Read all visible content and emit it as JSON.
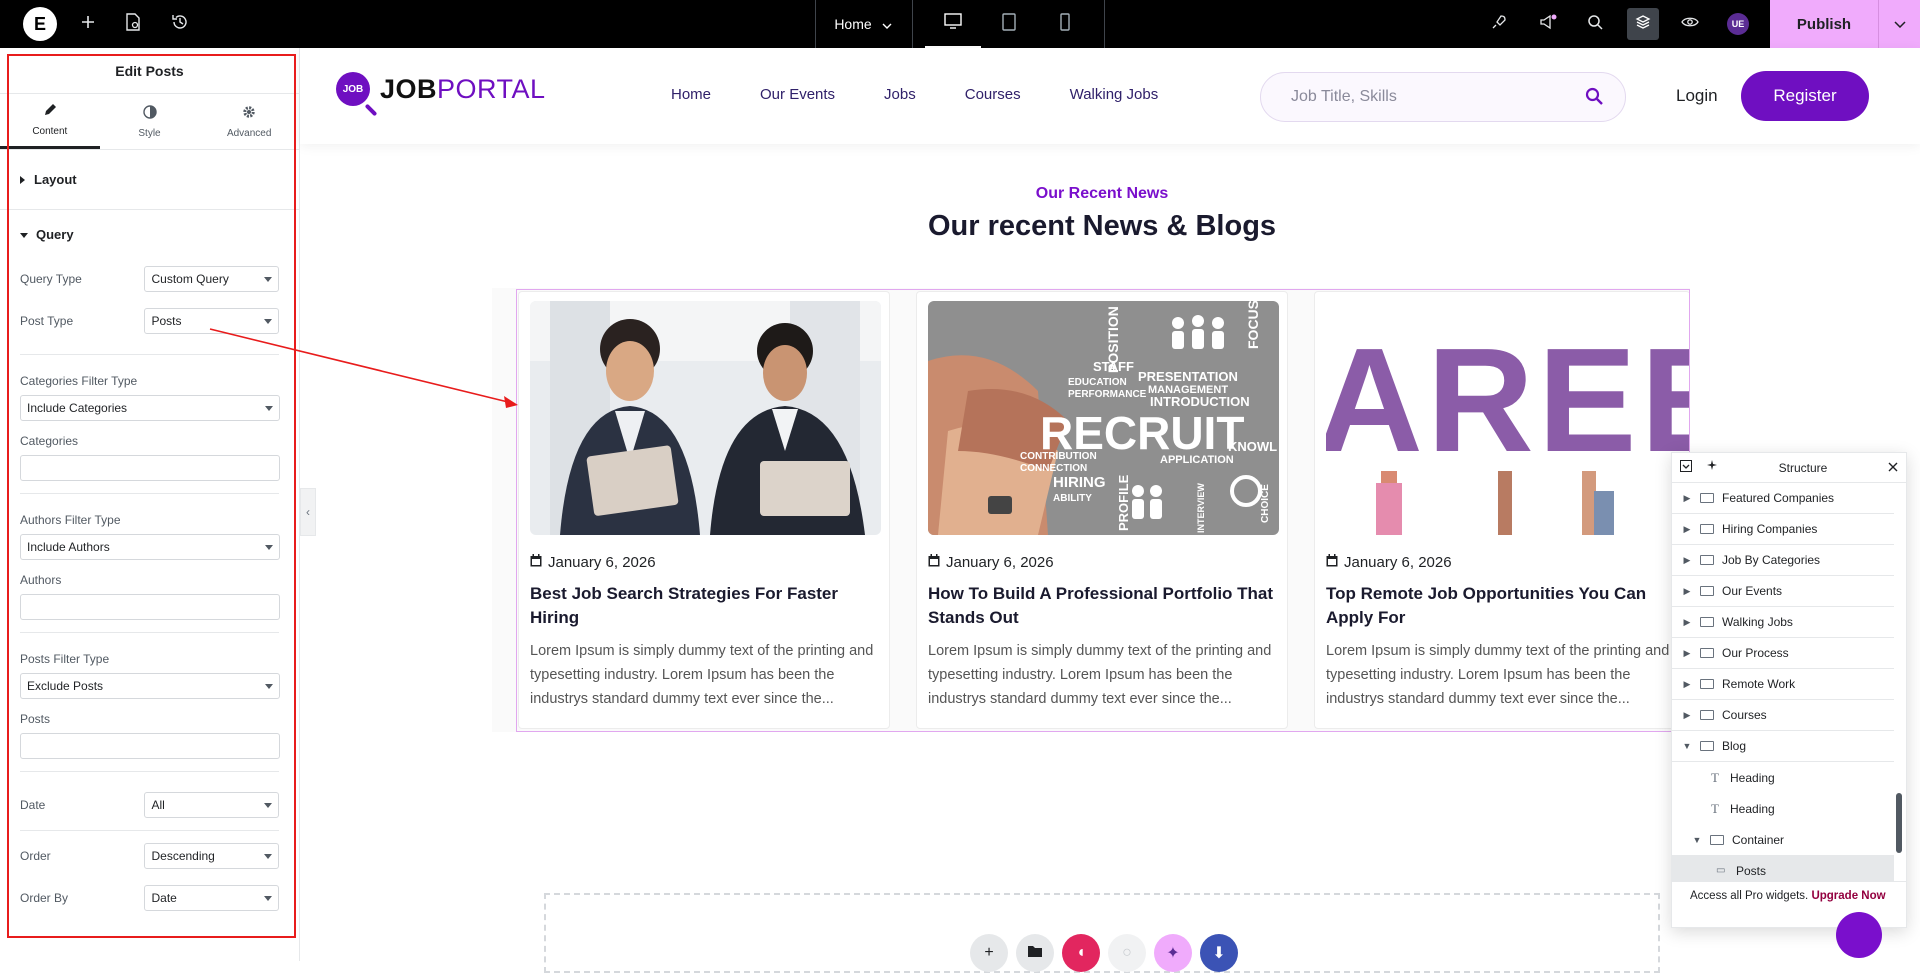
{
  "topbar": {
    "logo_letter": "E",
    "page_name": "Home",
    "publish_label": "Publish",
    "user_initials": "UE",
    "icons": [
      "plus-icon",
      "page-settings-icon",
      "history-icon",
      "rocket-icon",
      "megaphone-icon",
      "search-icon",
      "layers-icon",
      "eye-icon"
    ]
  },
  "panel": {
    "title": "Edit Posts",
    "tabs": [
      {
        "label": "Content",
        "icon": "pencil-icon"
      },
      {
        "label": "Style",
        "icon": "half-circle-icon"
      },
      {
        "label": "Advanced",
        "icon": "gear-icon"
      }
    ],
    "layout_label": "Layout",
    "query_label": "Query",
    "query_type": {
      "label": "Query Type",
      "value": "Custom Query"
    },
    "post_type": {
      "label": "Post Type",
      "value": "Posts"
    },
    "categories_filter": {
      "label": "Categories Filter Type",
      "value": "Include Categories"
    },
    "categories_label": "Categories",
    "authors_filter": {
      "label": "Authors Filter Type",
      "value": "Include Authors"
    },
    "authors_label": "Authors",
    "posts_filter": {
      "label": "Posts Filter Type",
      "value": "Exclude Posts"
    },
    "posts_label": "Posts",
    "date": {
      "label": "Date",
      "value": "All"
    },
    "order": {
      "label": "Order",
      "value": "Descending"
    },
    "order_by": {
      "label": "Order By",
      "value": "Date"
    }
  },
  "site": {
    "brand_mark": "JOB",
    "brand_job": "JOB",
    "brand_portal": "PORTAL",
    "nav": [
      "Home",
      "Our Events",
      "Jobs",
      "Courses",
      "Walking Jobs"
    ],
    "search_placeholder": "Job Title, Skills",
    "login": "Login",
    "register": "Register",
    "accent_color": "#6f0fc1"
  },
  "blog": {
    "eyebrow": "Our Recent News",
    "title": "Our recent News & Blogs",
    "posts": [
      {
        "date": "January 6, 2026",
        "title": "Best Job Search Strategies For Faster Hiring",
        "excerpt": "Lorem Ipsum is simply dummy text of the printing and typesetting industry. Lorem Ipsum has been the industrys standard dummy text ever since the..."
      },
      {
        "date": "January 6, 2026",
        "title": "How To Build A Professional Portfolio That Stands Out",
        "excerpt": "Lorem Ipsum is simply dummy text of the printing and typesetting industry. Lorem Ipsum has been the industrys standard dummy text ever since the...",
        "image_words": [
          "POSITION",
          "STAFF",
          "PRESENTATION",
          "EDUCATION",
          "MANAGEMENT",
          "PERFORMANCE",
          "INTRODUCTION",
          "RECRUIT",
          "CONTRIBUTION",
          "APPLICATION",
          "KNOWL",
          "CONNECTION",
          "HIRING",
          "ABILITY",
          "PROFILE",
          "INTERVIEW",
          "CHOICE",
          "FOCUS"
        ]
      },
      {
        "date": "January 6, 2026",
        "title": "Top Remote Job Opportunities You Can Apply For",
        "excerpt": "Lorem Ipsum is simply dummy text of the printing and typesetting industry. Lorem Ipsum has been the industrys standard dummy text ever since the...",
        "image_letters": "AREE"
      }
    ]
  },
  "navigator": {
    "title": "Structure",
    "items": [
      {
        "label": "Featured Companies"
      },
      {
        "label": "Hiring Companies"
      },
      {
        "label": "Job By Categories"
      },
      {
        "label": "Our Events"
      },
      {
        "label": "Walking Jobs"
      },
      {
        "label": "Our Process"
      },
      {
        "label": "Remote Work"
      },
      {
        "label": "Courses"
      },
      {
        "label": "Blog"
      },
      {
        "label": "Heading"
      },
      {
        "label": "Heading"
      },
      {
        "label": "Container"
      },
      {
        "label": "Posts"
      }
    ],
    "promo_text": "Access all Pro widgets.",
    "promo_link": "Upgrade Now"
  }
}
